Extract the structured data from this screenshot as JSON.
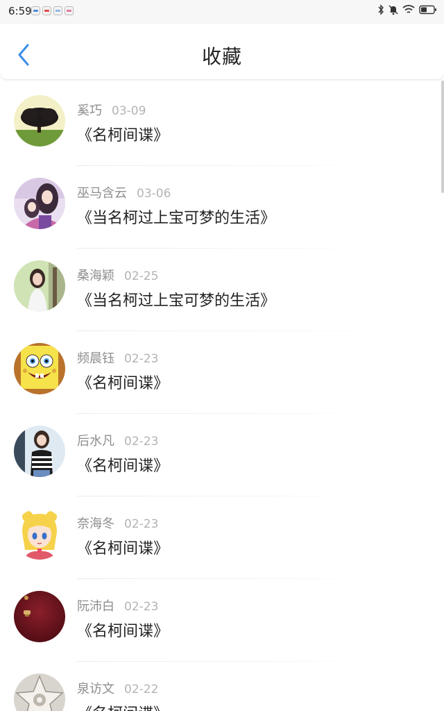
{
  "status_bar": {
    "time": "6:59",
    "icons": [
      "notification-app-icon",
      "notification-red-icon",
      "notification-shield-icon",
      "notification-pink-icon",
      "bluetooth-icon",
      "mute-icon",
      "wifi-icon",
      "battery-icon"
    ]
  },
  "header": {
    "title": "收藏",
    "back_icon": "chevron-left-icon"
  },
  "colors": {
    "accent": "#3a8ee6",
    "name_text": "#8e8e8e",
    "date_text": "#b3b3b3",
    "title_text": "#222222"
  },
  "favorites": [
    {
      "name": "奚巧",
      "date": "03-09",
      "title": "《名柯间谍》",
      "avatar": "tree-avatar"
    },
    {
      "name": "巫马含云",
      "date": "03-06",
      "title": "《当名柯过上宝可梦的生活》",
      "avatar": "anime-avatar"
    },
    {
      "name": "桑海颖",
      "date": "02-25",
      "title": "《当名柯过上宝可梦的生活》",
      "avatar": "girl-photo-avatar"
    },
    {
      "name": "频晨钰",
      "date": "02-23",
      "title": "《名柯间谍》",
      "avatar": "spongebob-avatar"
    },
    {
      "name": "后水凡",
      "date": "02-23",
      "title": "《名柯间谍》",
      "avatar": "girl-striped-avatar"
    },
    {
      "name": "奈海冬",
      "date": "02-23",
      "title": "《名柯间谍》",
      "avatar": "sailor-moon-avatar"
    },
    {
      "name": "阮沛白",
      "date": "02-23",
      "title": "《名柯间谍》",
      "avatar": "dark-red-avatar"
    },
    {
      "name": "泉访文",
      "date": "02-22",
      "title": "《名柯间谍》",
      "avatar": "star-avatar"
    }
  ]
}
